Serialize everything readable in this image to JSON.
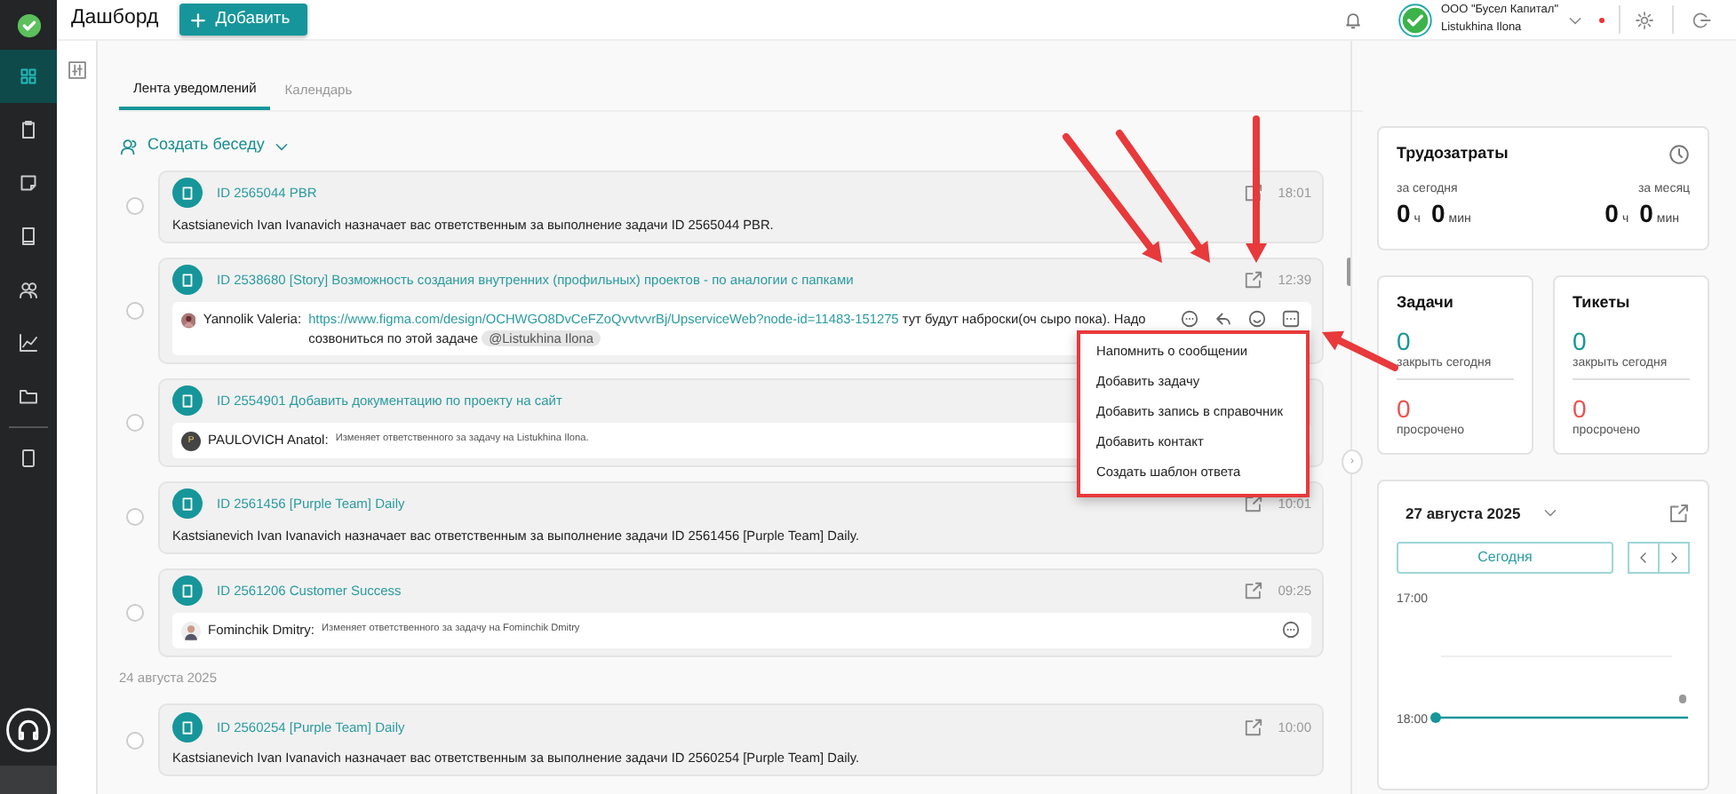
{
  "header": {
    "title": "Дашборд",
    "add_button": "Добавить",
    "org": "ООО \"Бусел Капитал\"",
    "user": "Listukhina Ilona",
    "alert_dot": true
  },
  "sidebar": [
    {
      "kind": "grid",
      "selected": true
    },
    {
      "kind": "clipboard",
      "selected": false
    },
    {
      "kind": "note",
      "selected": false
    },
    {
      "kind": "book",
      "selected": false
    },
    {
      "kind": "people",
      "selected": false
    },
    {
      "kind": "chart",
      "selected": false
    },
    {
      "kind": "folder",
      "selected": false
    },
    {
      "kind": "tablet",
      "selected": false
    }
  ],
  "tabs": [
    {
      "label": "Лента уведомлений",
      "selected": true
    },
    {
      "label": "Календарь",
      "selected": false
    }
  ],
  "create_chat": "Создать беседу",
  "feed": [
    {
      "kind": "notice",
      "selected": false,
      "title": "ID 2565044 PBR",
      "time": "18:01",
      "text": "Kastsianevich Ivan Ivanavich назначает вас ответственным за выполнение задачи ID 2565044 PBR."
    },
    {
      "kind": "comment",
      "selected": false,
      "title": "ID 2538680 [Story] Возможность создания внутренних (профильных) проектов - по аналогии с папками",
      "time": "12:39",
      "author": "Yannolik Valeria:",
      "link": "https://www.figma.com/design/OCHWGO8DvCeFZoQvvtvvrBj/UpserviceWeb?node-id=11483-151275",
      "text": " тут будут наброски(оч сыро пока). Надо созвониться по этой задаче",
      "mention": "@Listukhina Ilona",
      "actions": true,
      "small": false
    },
    {
      "kind": "comment",
      "selected": false,
      "title": "ID 2554901 Добавить документацию по проекту на сайт",
      "author": "PAULOVICH Anatol:",
      "text": "Изменяет ответственного за задачу на Listukhina Ilona.",
      "avatar_letter": "P",
      "actions": false,
      "small": true
    },
    {
      "kind": "notice",
      "selected": false,
      "title": "ID 2561456 [Purple Team] Daily",
      "time": "10:01",
      "text": "Kastsianevich Ivan Ivanavich назначает вас ответственным за выполнение задачи ID 2561456 [Purple Team] Daily."
    },
    {
      "kind": "comment",
      "selected": false,
      "title": "ID 2561206 Customer Success",
      "time": "09:25",
      "author": "Fominchik Dmitry:",
      "text": "Изменяет ответственного за задачу на Fominchik Dmitry",
      "actions": false,
      "comment_icon": true,
      "small": true
    },
    {
      "kind": "date",
      "text": "24 августа 2025"
    },
    {
      "kind": "notice",
      "selected": false,
      "title": "ID 2560254 [Purple Team] Daily",
      "time": "10:00",
      "text": "Kastsianevich Ivan Ivanavich назначает вас ответственным за выполнение задачи ID 2560254 [Purple Team] Daily."
    }
  ],
  "panel_toggle": "›",
  "context_menu": [
    "Напомнить о сообщении",
    "Добавить задачу",
    "Добавить запись в справочник",
    "Добавить контакт",
    "Создать шаблон ответа"
  ],
  "worktime": {
    "title": "Трудозатраты",
    "today_label": "за сегодня",
    "month_label": "за месяц",
    "today": [
      "0",
      "ч",
      "0",
      "мин"
    ],
    "month": [
      "0",
      "ч",
      "0",
      "мин"
    ]
  },
  "counters": [
    {
      "title": "Задачи",
      "value": "0",
      "value_label": "закрыть сегодня",
      "overdue": "0",
      "overdue_label": "просрочено"
    },
    {
      "title": "Тикеты",
      "value": "0",
      "value_label": "закрыть сегодня",
      "overdue": "0",
      "overdue_label": "просрочено"
    }
  ],
  "calendar": {
    "date": "27 августа 2025",
    "today_button": "Сегодня",
    "times": [
      "17:00",
      "18:00"
    ]
  }
}
